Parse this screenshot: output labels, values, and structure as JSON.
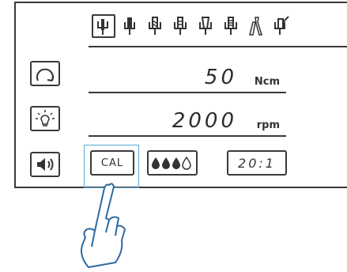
{
  "tools": [
    {
      "icon": "handpiece-straight-icon",
      "selected": true
    },
    {
      "icon": "handpiece-bur-icon",
      "selected": false
    },
    {
      "icon": "handpiece-drill-icon",
      "selected": false
    },
    {
      "icon": "handpiece-drill-2-icon",
      "selected": false
    },
    {
      "icon": "handpiece-taper-icon",
      "selected": false
    },
    {
      "icon": "handpiece-tap-icon",
      "selected": false
    },
    {
      "icon": "handpiece-wrench-icon",
      "selected": false
    },
    {
      "icon": "handpiece-angle-icon",
      "selected": false
    }
  ],
  "torque": {
    "value": "50",
    "unit": "Ncm",
    "icon": "rotation-direction-icon"
  },
  "speed": {
    "value": "2000",
    "unit": "rpm",
    "icon": "light-bulb-icon"
  },
  "sound": {
    "icon": "speaker-icon"
  },
  "cal": {
    "label": "CAL"
  },
  "irrigation": {
    "icon": "irrigation-drops-icon",
    "level": 3,
    "max": 4
  },
  "ratio": {
    "value": "20:1"
  },
  "colors": {
    "line": "#3a3a3a",
    "highlight": "#5aa9d6"
  }
}
